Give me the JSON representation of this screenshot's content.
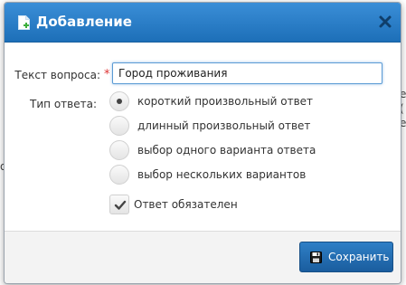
{
  "dialog": {
    "title": "Добавление",
    "icons": {
      "title": "add-document-icon",
      "close": "close-icon",
      "save": "floppy-disk-icon"
    },
    "colors": {
      "titlebar": "#2a7fc9",
      "primary_button": "#1f69ad",
      "required": "#dd3333"
    }
  },
  "form": {
    "question_label": "Текст вопроса:",
    "required_mark": "*",
    "question_value": "Город проживания",
    "answer_type_label": "Тип ответа:",
    "answer_types": [
      {
        "label": "короткий произвольный ответ",
        "selected": true
      },
      {
        "label": "длинный произвольный ответ",
        "selected": false
      },
      {
        "label": "выбор одного варианта ответа",
        "selected": false
      },
      {
        "label": "выбор нескольких вариантов",
        "selected": false
      }
    ],
    "required_checkbox": {
      "label": "Ответ обязателен",
      "checked": true
    }
  },
  "footer": {
    "save_label": "Сохранить"
  }
}
